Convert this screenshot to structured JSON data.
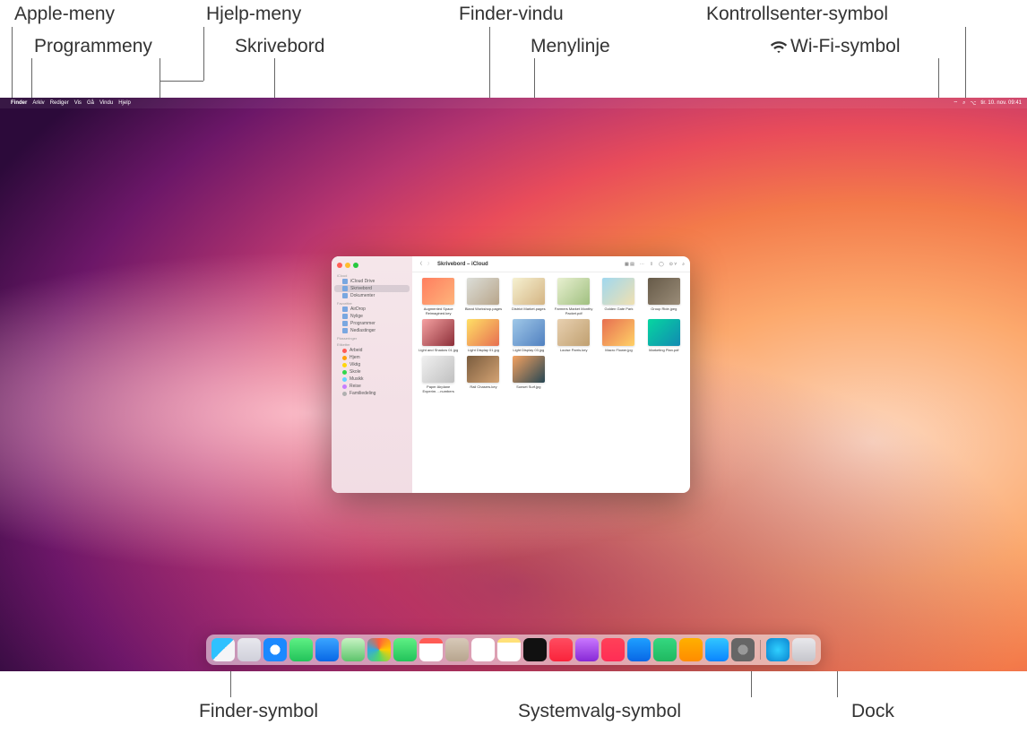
{
  "callouts": {
    "apple_menu": "Apple-meny",
    "app_menu": "Programmeny",
    "help_menu": "Hjelp-meny",
    "desktop": "Skrivebord",
    "finder_window": "Finder-vindu",
    "menu_bar": "Menylinje",
    "control_center": "Kontrollsenter-symbol",
    "wifi_symbol": "Wi-Fi-symbol",
    "finder_icon": "Finder-symbol",
    "sysprefs_icon": "Systemvalg-symbol",
    "dock": "Dock"
  },
  "menubar": {
    "app": "Finder",
    "items": [
      "Arkiv",
      "Rediger",
      "Vis",
      "Gå",
      "Vindu",
      "Hjelp"
    ],
    "clock": "tir. 10. nov.  09:41"
  },
  "finder": {
    "title": "Skrivebord – iCloud",
    "sections": {
      "icloud_label": "iCloud",
      "icloud": [
        "iCloud Drive",
        "Skrivebord",
        "Dokumenter"
      ],
      "fav_label": "Favoritter",
      "fav": [
        "AirDrop",
        "Nylige",
        "Programmer",
        "Nedlastinger"
      ],
      "places_label": "Plasseringer",
      "tags_label": "Etiketter",
      "tags": [
        {
          "name": "Arbeid",
          "color": "#ff5b55"
        },
        {
          "name": "Hjem",
          "color": "#ff9f0a"
        },
        {
          "name": "Viktig",
          "color": "#ffd60a"
        },
        {
          "name": "Skole",
          "color": "#32d74b"
        },
        {
          "name": "Musikk",
          "color": "#64d2ff"
        },
        {
          "name": "Reise",
          "color": "#c77dff"
        },
        {
          "name": "Familiedeling",
          "color": "#b0b0b0"
        }
      ]
    },
    "files": [
      {
        "name": "Augmented Space Reimagined.key",
        "c1": "#ff7e5f",
        "c2": "#feb47b"
      },
      {
        "name": "Bland Workshop.pages",
        "c1": "#dcded8",
        "c2": "#b8a58a"
      },
      {
        "name": "District Market.pages",
        "c1": "#f6f1d1",
        "c2": "#d4b483"
      },
      {
        "name": "Farmers Market Monthy Packet.pdf",
        "c1": "#e8f0d0",
        "c2": "#a0c080"
      },
      {
        "name": "Golden Gate Park",
        "c1": "#a0d8ef",
        "c2": "#f0e0b0"
      },
      {
        "name": "Group Ride.jpeg",
        "c1": "#665a48",
        "c2": "#9a8c78"
      },
      {
        "name": "Light and Shadow 01.jpg",
        "c1": "#f5a1a1",
        "c2": "#8c2f39"
      },
      {
        "name": "Light Display 01.jpg",
        "c1": "#ffe066",
        "c2": "#e76f51"
      },
      {
        "name": "Light Display 03.jpg",
        "c1": "#a0c8e8",
        "c2": "#5080c0"
      },
      {
        "name": "Louise Parris.key",
        "c1": "#e8d0b0",
        "c2": "#c0a070"
      },
      {
        "name": "Macro Flower.jpg",
        "c1": "#e76f51",
        "c2": "#ffd166"
      },
      {
        "name": "Marketing Plan.pdf",
        "c1": "#06d6a0",
        "c2": "#118ab2"
      },
      {
        "name": "Paper Airplane Experim….numbers",
        "c1": "#f0f0f0",
        "c2": "#c0c0c0"
      },
      {
        "name": "Rail Chasers.key",
        "c1": "#7a5c3e",
        "c2": "#d4a373"
      },
      {
        "name": "Sunset Surf.jpg",
        "c1": "#f4a261",
        "c2": "#264653"
      }
    ]
  },
  "dock": {
    "apps": [
      {
        "name": "finder",
        "bg": "linear-gradient(135deg,#2ec1ff 50%,#f5f5f7 50%)"
      },
      {
        "name": "launchpad",
        "bg": "linear-gradient(#e8e8ee,#d0d0da)"
      },
      {
        "name": "safari",
        "bg": "radial-gradient(circle,#fff 30%,#1b89ff 31%)"
      },
      {
        "name": "messages",
        "bg": "linear-gradient(#5ef084,#22c35a)"
      },
      {
        "name": "mail",
        "bg": "linear-gradient(#3aa5ff,#0867e6)"
      },
      {
        "name": "maps",
        "bg": "linear-gradient(#c7f3c3,#5dc46b)"
      },
      {
        "name": "photos",
        "bg": "conic-gradient(#ff5e3a,#ffcd00,#53d769,#34aadc,#ff5e3a)"
      },
      {
        "name": "facetime",
        "bg": "linear-gradient(#5ef084,#22c35a)"
      },
      {
        "name": "calendar",
        "bg": "linear-gradient(#ff5b55 24%,#fff 24%)"
      },
      {
        "name": "contacts",
        "bg": "linear-gradient(#d7c9b8,#b7a58e)"
      },
      {
        "name": "reminders",
        "bg": "#fff"
      },
      {
        "name": "notes",
        "bg": "linear-gradient(#ffe178 20%,#fff 20%)"
      },
      {
        "name": "tv",
        "bg": "#111"
      },
      {
        "name": "music",
        "bg": "linear-gradient(#ff4c60,#fa233b)"
      },
      {
        "name": "podcasts",
        "bg": "linear-gradient(#c977ff,#8728d6)"
      },
      {
        "name": "news",
        "bg": "linear-gradient(#ff4158,#ff2d55)"
      },
      {
        "name": "keynote",
        "bg": "linear-gradient(#1e9fff,#0867e6)"
      },
      {
        "name": "numbers",
        "bg": "linear-gradient(#34d880,#20b860)"
      },
      {
        "name": "pages",
        "bg": "linear-gradient(#ffb000,#ff8c00)"
      },
      {
        "name": "appstore",
        "bg": "linear-gradient(#31c6ff,#0a84ff)"
      },
      {
        "name": "system-preferences",
        "bg": "radial-gradient(circle,#999 30%,#666 31%)"
      }
    ],
    "right": [
      {
        "name": "downloads",
        "bg": "radial-gradient(circle,#2fd0ff,#0a84d0)"
      },
      {
        "name": "trash",
        "bg": "linear-gradient(#e8e8ec,#c6c6cc)"
      }
    ]
  }
}
